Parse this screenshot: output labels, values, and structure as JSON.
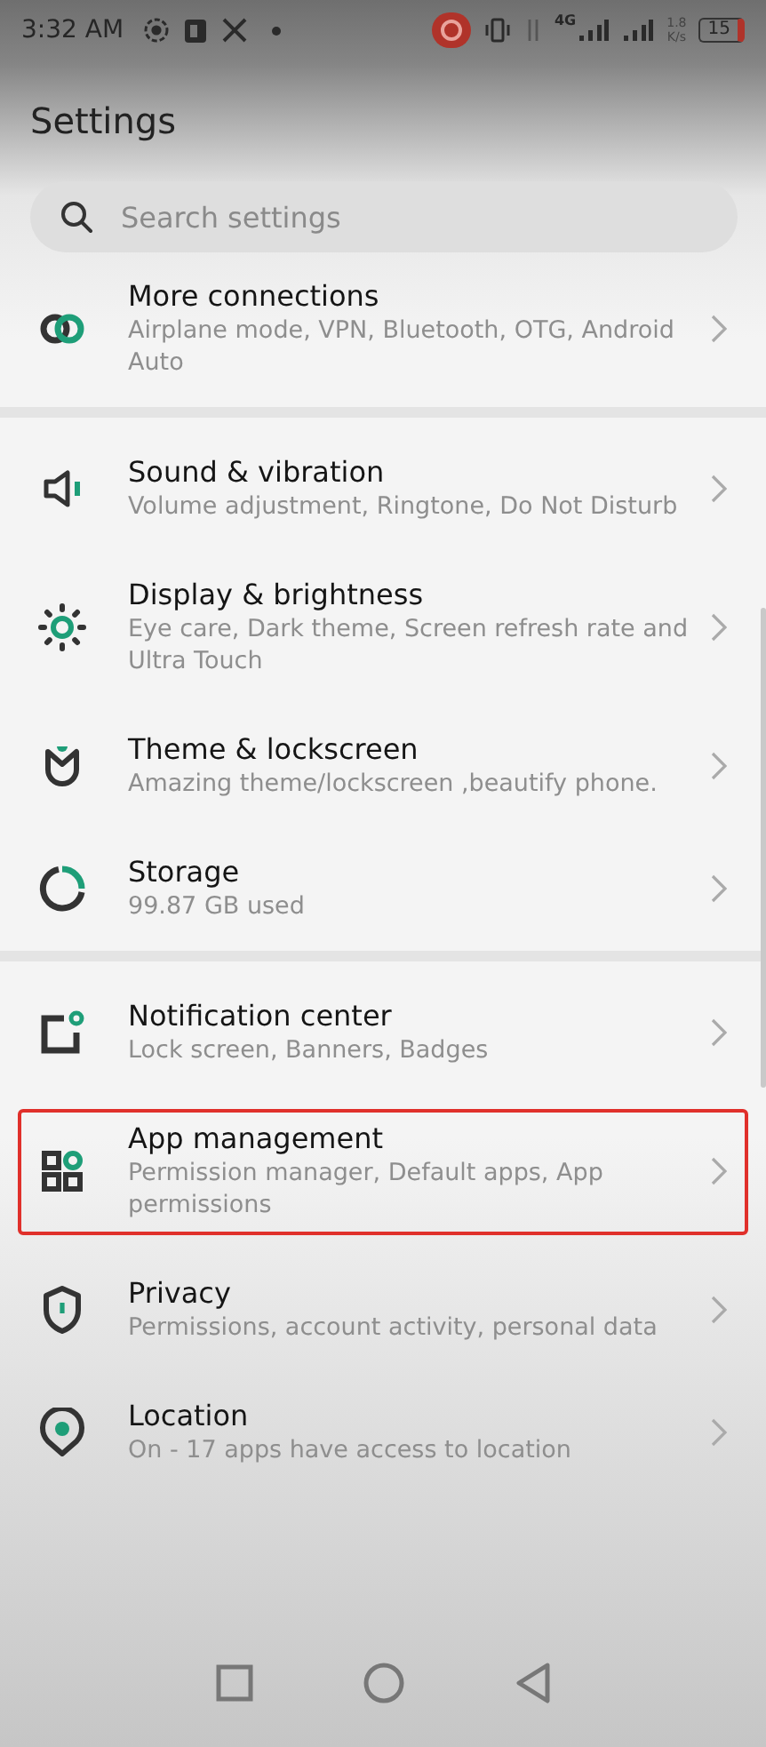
{
  "status_bar": {
    "time": "3:32 AM",
    "network": "4G",
    "speed_value": "1.8",
    "speed_unit": "K/s",
    "battery": "15"
  },
  "title": "Settings",
  "search": {
    "placeholder": "Search settings"
  },
  "groups": [
    {
      "items": [
        {
          "kind": "link",
          "title": "More connections",
          "subtitle": "Airplane mode, VPN, Bluetooth, OTG, Android Auto",
          "highlighted": false
        }
      ]
    },
    {
      "items": [
        {
          "kind": "speaker",
          "title": "Sound & vibration",
          "subtitle": "Volume adjustment, Ringtone, Do Not Disturb",
          "highlighted": false
        },
        {
          "kind": "sun",
          "title": "Display & brightness",
          "subtitle": "Eye care, Dark theme, Screen refresh rate and Ultra Touch",
          "highlighted": false
        },
        {
          "kind": "theme",
          "title": "Theme & lockscreen",
          "subtitle": "Amazing theme/lockscreen ,beautify phone.",
          "highlighted": false
        },
        {
          "kind": "storage",
          "title": "Storage",
          "subtitle": "99.87 GB used",
          "highlighted": false
        }
      ]
    },
    {
      "items": [
        {
          "kind": "notification",
          "title": "Notification center",
          "subtitle": "Lock screen, Banners, Badges",
          "highlighted": false
        },
        {
          "kind": "apps",
          "title": "App management",
          "subtitle": "Permission manager, Default apps, App permissions",
          "highlighted": true
        },
        {
          "kind": "shield",
          "title": "Privacy",
          "subtitle": "Permissions, account activity, personal data",
          "highlighted": false
        },
        {
          "kind": "location",
          "title": "Location",
          "subtitle": "On - 17 apps have access to location",
          "highlighted": false
        }
      ]
    }
  ]
}
